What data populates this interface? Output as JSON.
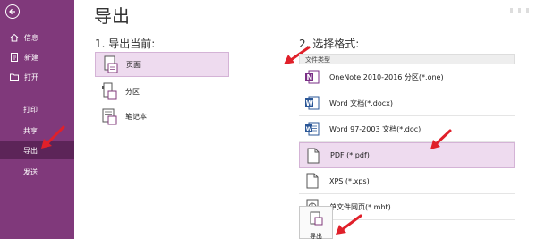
{
  "sidebar": {
    "items": [
      {
        "label": "信息",
        "icon": "home-icon"
      },
      {
        "label": "新建",
        "icon": "new-page-icon"
      },
      {
        "label": "打开",
        "icon": "folder-icon"
      },
      {
        "label": "打印"
      },
      {
        "label": "共享"
      },
      {
        "label": "导出"
      },
      {
        "label": "发送"
      }
    ],
    "active_index": 5
  },
  "main": {
    "title": "导出",
    "export_current": {
      "heading": "1. 导出当前:",
      "options": [
        {
          "label": "页面",
          "icon": "page-icon",
          "selected": true
        },
        {
          "label": "分区",
          "icon": "section-icon",
          "selected": false
        },
        {
          "label": "笔记本",
          "icon": "notebook-icon",
          "selected": false
        }
      ]
    },
    "format": {
      "heading": "2. 选择格式:",
      "column_header": "文件类型",
      "options": [
        {
          "label": "OneNote 2010-2016 分区(*.one)",
          "icon": "onenote-icon",
          "selected": false
        },
        {
          "label": "Word 文档(*.docx)",
          "icon": "word-icon",
          "selected": false
        },
        {
          "label": "Word 97-2003 文档(*.doc)",
          "icon": "word-97-icon",
          "selected": false
        },
        {
          "label": "PDF (*.pdf)",
          "icon": "pdf-icon",
          "selected": true
        },
        {
          "label": "XPS (*.xps)",
          "icon": "xps-icon",
          "selected": false
        },
        {
          "label": "单文件网页(*.mht)",
          "icon": "web-page-icon",
          "selected": false
        }
      ]
    },
    "export_button": {
      "label": "导出"
    }
  },
  "colors": {
    "sidebar_bg": "#80397b",
    "sidebar_active": "#5c2458",
    "selected_bg": "#eedbef",
    "annotation_arrow": "#e0202a"
  }
}
